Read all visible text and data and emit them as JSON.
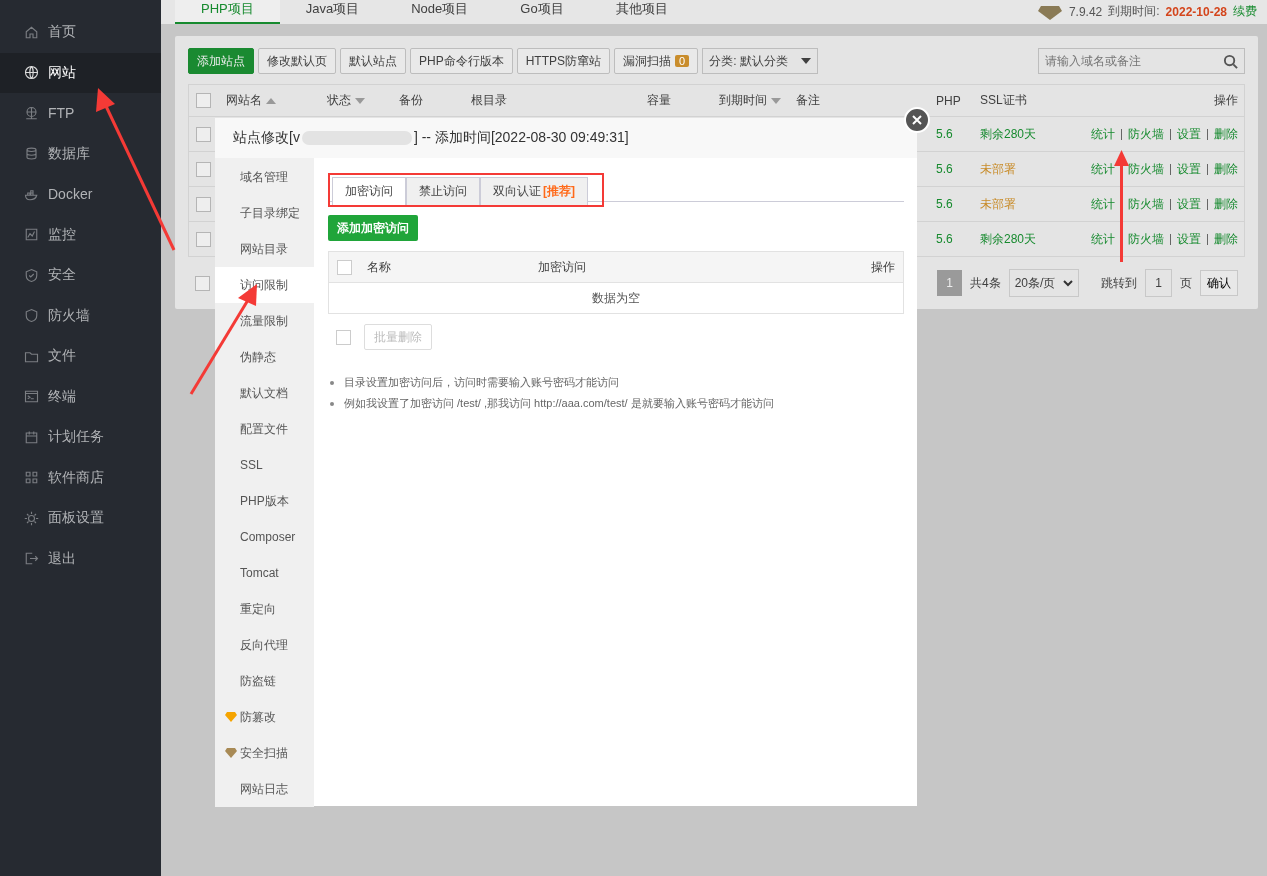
{
  "sidebar": {
    "items": [
      {
        "label": "首页",
        "selected": false
      },
      {
        "label": "网站",
        "selected": true
      },
      {
        "label": "FTP",
        "selected": false
      },
      {
        "label": "数据库",
        "selected": false
      },
      {
        "label": "Docker",
        "selected": false
      },
      {
        "label": "监控",
        "selected": false
      },
      {
        "label": "安全",
        "selected": false
      },
      {
        "label": "防火墙",
        "selected": false
      },
      {
        "label": "文件",
        "selected": false
      },
      {
        "label": "终端",
        "selected": false
      },
      {
        "label": "计划任务",
        "selected": false
      },
      {
        "label": "软件商店",
        "selected": false
      },
      {
        "label": "面板设置",
        "selected": false
      },
      {
        "label": "退出",
        "selected": false
      }
    ]
  },
  "top_tabs": [
    {
      "label": "PHP项目",
      "selected": true
    },
    {
      "label": "Java项目",
      "selected": false
    },
    {
      "label": "Node项目",
      "selected": false
    },
    {
      "label": "Go项目",
      "selected": false
    },
    {
      "label": "其他项目",
      "selected": false
    }
  ],
  "top_right": {
    "version": "7.9.42",
    "expiry_label": "到期时间:",
    "expiry_date": "2022-10-28",
    "renew": "续费"
  },
  "toolbar": {
    "buttons": [
      {
        "label": "添加站点",
        "kind": "primary"
      },
      {
        "label": "修改默认页",
        "kind": "default"
      },
      {
        "label": "默认站点",
        "kind": "default"
      },
      {
        "label": "PHP命令行版本",
        "kind": "default"
      },
      {
        "label": "HTTPS防窜站",
        "kind": "default"
      },
      {
        "label": "漏洞扫描",
        "kind": "count",
        "count": "0"
      }
    ],
    "category": "分类: 默认分类",
    "search": {
      "placeholder": "请输入域名或备注"
    }
  },
  "table": {
    "header_checked": false,
    "columns": [
      {
        "label": "网站名",
        "sorted": true,
        "ascending": true
      },
      {
        "label": "状态",
        "sorted": true,
        "ascending": false
      },
      {
        "label": "备份"
      },
      {
        "label": "根目录"
      },
      {
        "label": "容量"
      },
      {
        "label": "到期时间",
        "sorted": true,
        "ascending": false
      },
      {
        "label": "备注"
      },
      {
        "label": "PHP"
      },
      {
        "label": "SSL证书"
      },
      {
        "label": "操作"
      }
    ],
    "rows": [
      {
        "checked": false,
        "php": "5.6",
        "ssl": "剩余280天",
        "deployed": true,
        "actions": [
          "统计",
          "防火墙",
          "设置",
          "删除"
        ]
      },
      {
        "checked": false,
        "php": "5.6",
        "ssl": "未部署",
        "deployed": false,
        "actions": [
          "统计",
          "防火墙",
          "设置",
          "删除"
        ]
      },
      {
        "checked": false,
        "php": "5.6",
        "ssl": "未部署",
        "deployed": false,
        "actions": [
          "统计",
          "防火墙",
          "设置",
          "删除"
        ]
      },
      {
        "checked": false,
        "php": "5.6",
        "ssl": "剩余280天",
        "deployed": true,
        "actions": [
          "统计",
          "防火墙",
          "设置",
          "删除"
        ]
      }
    ]
  },
  "pagination": {
    "checked": false,
    "current": "1",
    "total": "共4条",
    "page_size": "20条/页",
    "jump_label": "跳转到",
    "jump_value": "1",
    "page_unit": "页",
    "confirm": "确认"
  },
  "dialog": {
    "title_prefix": "站点修改[v",
    "title_suffix": "] -- 添加时间[2022-08-30 09:49:31]",
    "menu": [
      {
        "label": "域名管理",
        "selected": false
      },
      {
        "label": "子目录绑定",
        "selected": false
      },
      {
        "label": "网站目录",
        "selected": false
      },
      {
        "label": "访问限制",
        "selected": true
      },
      {
        "label": "流量限制",
        "selected": false
      },
      {
        "label": "伪静态",
        "selected": false
      },
      {
        "label": "默认文档",
        "selected": false
      },
      {
        "label": "配置文件",
        "selected": false
      },
      {
        "label": "SSL",
        "selected": false
      },
      {
        "label": "PHP版本",
        "selected": false
      },
      {
        "label": "Composer",
        "selected": false
      },
      {
        "label": "Tomcat",
        "selected": false
      },
      {
        "label": "重定向",
        "selected": false
      },
      {
        "label": "反向代理",
        "selected": false
      },
      {
        "label": "防盗链",
        "selected": false
      },
      {
        "label": "防篡改",
        "selected": false,
        "color": "#f5a400"
      },
      {
        "label": "安全扫描",
        "selected": false,
        "color": "#a88a55"
      },
      {
        "label": "网站日志",
        "selected": false
      }
    ],
    "tabs": [
      {
        "label": "加密访问",
        "selected": true
      },
      {
        "label": "禁止访问",
        "selected": false
      },
      {
        "label": "双向认证",
        "tag": "[推荐]",
        "selected": false
      }
    ],
    "add_button": "添加加密访问",
    "table": {
      "header_checked": false,
      "columns": [
        "名称",
        "加密访问",
        "操作"
      ],
      "empty": "数据为空"
    },
    "batch_delete": {
      "checked": false,
      "label": "批量删除",
      "disabled": true
    },
    "hints": [
      "目录设置加密访问后，访问时需要输入账号密码才能访问",
      "例如我设置了加密访问 /test/ ,那我访问 http://aaa.com/test/ 是就要输入账号密码才能访问"
    ]
  }
}
